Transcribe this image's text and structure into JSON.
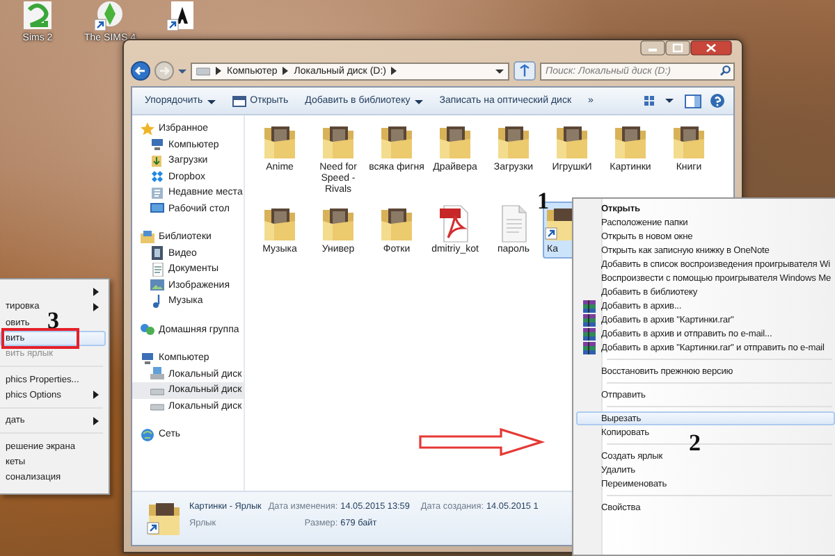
{
  "desktop_icons": [
    {
      "kind": "sims2",
      "label": "Sims 2"
    },
    {
      "kind": "sims4",
      "label": "The SIMS 4"
    },
    {
      "kind": "font"
    }
  ],
  "explorer": {
    "breadcrumb": [
      "Компьютер",
      "Локальный диск (D:)"
    ],
    "search": {
      "placeholder": "Поиск: Локальный диск (D:)"
    },
    "toolbar": [
      {
        "label": "Упорядочить",
        "kind": "plain",
        "dropdown": true
      },
      {
        "label": "Открыть",
        "kind": "open",
        "dropdown": false
      },
      {
        "label": "Добавить в библиотеку",
        "kind": "plain",
        "dropdown": true
      },
      {
        "label": "Записать на оптический диск",
        "kind": "plain",
        "dropdown": false
      },
      {
        "label": "»",
        "kind": "plain",
        "dropdown": false
      }
    ],
    "nav": [
      {
        "label": "Избранное",
        "kind": "star",
        "selected": false,
        "children": [
          {
            "label": "Компьютер",
            "kind": "computer",
            "selected": false
          },
          {
            "label": "Загрузки",
            "kind": "downloads",
            "selected": false
          },
          {
            "label": "Dropbox",
            "kind": "dropbox",
            "selected": false
          },
          {
            "label": "Недавние места",
            "kind": "recent",
            "selected": false
          },
          {
            "label": "Рабочий стол",
            "kind": "desktop",
            "selected": false
          }
        ]
      },
      {
        "label": "Библиотеки",
        "kind": "libraries",
        "selected": false,
        "children": [
          {
            "label": "Видео",
            "kind": "video",
            "selected": false
          },
          {
            "label": "Документы",
            "kind": "documents",
            "selected": false
          },
          {
            "label": "Изображения",
            "kind": "images",
            "selected": false
          },
          {
            "label": "Музыка",
            "kind": "music",
            "selected": false
          }
        ]
      },
      {
        "label": "Домашняя группа",
        "kind": "homegroup",
        "selected": false
      },
      {
        "label": "Компьютер",
        "kind": "computer",
        "selected": false,
        "children": [
          {
            "label": "Локальный диск",
            "kind": "systemdisk",
            "selected": false
          },
          {
            "label": "Локальный диск",
            "kind": "disk",
            "selected": true
          },
          {
            "label": "Локальный диск",
            "kind": "disk",
            "selected": false
          }
        ]
      },
      {
        "label": "Сеть",
        "kind": "network",
        "selected": false
      }
    ],
    "files": [
      {
        "label": "Anime",
        "kind": "folder",
        "selected": false
      },
      {
        "label": "Need for Speed - Rivals",
        "kind": "folder",
        "selected": false
      },
      {
        "label": "всяка фигня",
        "kind": "folder",
        "selected": false
      },
      {
        "label": "Драйвера",
        "kind": "folder",
        "selected": false
      },
      {
        "label": "Загрузки",
        "kind": "folder",
        "selected": false
      },
      {
        "label": "ИгрушкИ",
        "kind": "folder",
        "selected": false
      },
      {
        "label": "Картинки",
        "kind": "folder",
        "selected": false
      },
      {
        "label": "Книги",
        "kind": "folder",
        "selected": false
      },
      {
        "label": "Музыка",
        "kind": "folder",
        "selected": false
      },
      {
        "label": "Универ",
        "kind": "folder",
        "selected": false
      },
      {
        "label": "Фотки",
        "kind": "folder",
        "selected": false
      },
      {
        "label": "dmitriy_kot",
        "kind": "pdf",
        "selected": false
      },
      {
        "label": "пароль",
        "kind": "text",
        "selected": false
      },
      {
        "label": "Ка",
        "kind": "shortcut",
        "selected": true
      }
    ],
    "status": {
      "name": "Картинки - Ярлык",
      "type": "Ярлык",
      "fields": [
        {
          "label": "Дата изменения:",
          "value": "14.05.2015 13:59"
        },
        {
          "label": "Размер:",
          "value": "679 байт"
        },
        {
          "label": "Дата создания:",
          "value": "14.05.2015 1"
        }
      ]
    }
  },
  "desktop_menu": {
    "items": [
      {
        "kind": "item",
        "submenu": true,
        "selected": false,
        "marked": false
      },
      {
        "kind": "item",
        "label": "тировка",
        "submenu": true,
        "selected": false,
        "disabled": false,
        "marked": false
      },
      {
        "kind": "item",
        "label": "овить",
        "submenu": false,
        "selected": false,
        "disabled": false,
        "marked": false
      },
      {
        "kind": "item",
        "label": "вить",
        "submenu": false,
        "selected": true,
        "disabled": false,
        "marked": true
      },
      {
        "kind": "item",
        "label": "вить ярлык",
        "submenu": false,
        "selected": false,
        "disabled": true,
        "marked": false
      },
      {
        "kind": "separator"
      },
      {
        "kind": "item",
        "label": "phics Properties...",
        "submenu": false,
        "selected": false,
        "disabled": false,
        "marked": false
      },
      {
        "kind": "item",
        "label": "phics Options",
        "submenu": true,
        "selected": false,
        "disabled": false,
        "marked": false
      },
      {
        "kind": "separator"
      },
      {
        "kind": "item",
        "label": "дать",
        "submenu": true,
        "selected": false,
        "disabled": false,
        "marked": false
      },
      {
        "kind": "separator"
      },
      {
        "kind": "item",
        "label": "решение экрана",
        "submenu": false,
        "selected": false,
        "disabled": false,
        "marked": false
      },
      {
        "kind": "item",
        "label": "кеты",
        "submenu": false,
        "selected": false,
        "disabled": false,
        "marked": false
      },
      {
        "kind": "item",
        "label": "сонализация",
        "submenu": false,
        "selected": false,
        "disabled": false,
        "marked": false
      }
    ]
  },
  "file_menu": {
    "items": [
      {
        "kind": "item",
        "label": "Открыть",
        "default": true,
        "selected": false
      },
      {
        "kind": "item",
        "label": "Расположение папки",
        "default": false,
        "selected": false
      },
      {
        "kind": "item",
        "label": "Открыть в новом окне",
        "default": false,
        "selected": false
      },
      {
        "kind": "item",
        "label": "Открыть как записную книжку в OneNote",
        "default": false,
        "selected": false
      },
      {
        "kind": "item",
        "label": "Добавить в список воспроизведения проигрывателя Wi",
        "default": false,
        "selected": false
      },
      {
        "kind": "item",
        "label": "Воспроизвести с помощью проигрывателя Windows Me",
        "default": false,
        "selected": false
      },
      {
        "kind": "item",
        "label": "Добавить в библиотеку",
        "default": false,
        "selected": false
      },
      {
        "kind": "archive",
        "label": "Добавить в архив...",
        "default": false,
        "selected": false
      },
      {
        "kind": "archive",
        "label": "Добавить в архив \"Картинки.rar\"",
        "default": false,
        "selected": false
      },
      {
        "kind": "archive",
        "label": "Добавить в архив и отправить по e-mail...",
        "default": false,
        "selected": false
      },
      {
        "kind": "archive",
        "label": "Добавить в архив \"Картинки.rar\" и отправить по e-mail",
        "default": false,
        "selected": false
      },
      {
        "kind": "separator"
      },
      {
        "kind": "item",
        "label": "Восстановить прежнюю версию",
        "default": false,
        "selected": false
      },
      {
        "kind": "separator"
      },
      {
        "kind": "item",
        "label": "Отправить",
        "default": false,
        "selected": false
      },
      {
        "kind": "separator"
      },
      {
        "kind": "item",
        "label": "Вырезать",
        "default": false,
        "selected": true
      },
      {
        "kind": "item",
        "label": "Копировать",
        "default": false,
        "selected": false
      },
      {
        "kind": "separator"
      },
      {
        "kind": "item",
        "label": "Создать ярлык",
        "default": false,
        "selected": false
      },
      {
        "kind": "item",
        "label": "Удалить",
        "default": false,
        "selected": false
      },
      {
        "kind": "item",
        "label": "Переименовать",
        "default": false,
        "selected": false
      },
      {
        "kind": "separator"
      },
      {
        "kind": "item",
        "label": "Свойства",
        "default": false,
        "selected": false
      }
    ]
  },
  "annotations": [
    {
      "text": "1"
    },
    {
      "text": "2"
    },
    {
      "text": "3"
    }
  ]
}
